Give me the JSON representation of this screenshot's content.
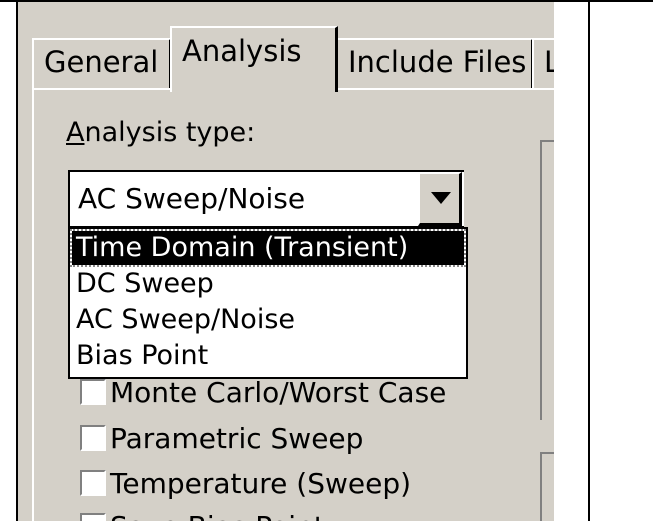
{
  "tabs": [
    {
      "label": "General"
    },
    {
      "label": "Analysis"
    },
    {
      "label": "Include Files"
    },
    {
      "label": "L"
    }
  ],
  "analysis_type": {
    "label_mnemonic": "A",
    "label_rest": "nalysis type:",
    "selected_value": "AC Sweep/Noise"
  },
  "dropdown": {
    "options": [
      "Time Domain (Transient)",
      "DC Sweep",
      "AC Sweep/Noise",
      "Bias Point"
    ],
    "highlighted_index": 0
  },
  "options": [
    {
      "label": "Monte Carlo/Worst Case",
      "checked": false
    },
    {
      "label": "Parametric Sweep",
      "checked": false
    },
    {
      "label": "Temperature (Sweep)",
      "checked": false
    },
    {
      "label": "Save Bias Point",
      "checked": false
    }
  ],
  "icons": {
    "dropdown_arrow": "chevron-down-icon"
  },
  "colors": {
    "dialog_bg": "#d4d0c8",
    "selection_bg": "#000000"
  }
}
